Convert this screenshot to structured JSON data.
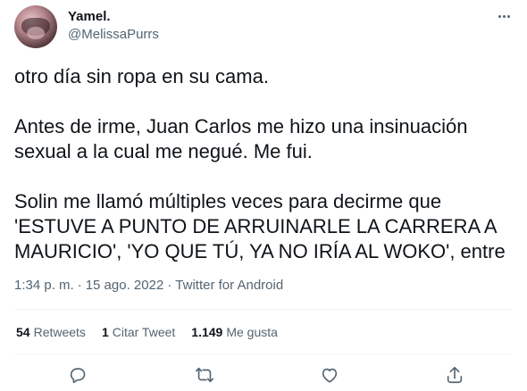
{
  "author": {
    "display_name": "Yamel.",
    "handle": "@MelissaPurrs"
  },
  "tweet": {
    "text": "otro día sin ropa en su cama.\n\nAntes de irme, Juan Carlos me hizo una insinuación\nsexual a la cual me negué. Me fui.\n\nSolin me llamó múltiples veces para decirme que\n'ESTUVE A PUNTO DE ARRUINARLE LA CARRERA A\nMAURICIO', 'YO QUE TÚ, YA NO IRÍA AL WOKO', entre"
  },
  "meta": {
    "time": "1:34 p. m.",
    "separator": "·",
    "date": "15 ago. 2022",
    "source": "Twitter for Android"
  },
  "stats": {
    "retweets_count": "54",
    "retweets_label": "Retweets",
    "quotes_count": "1",
    "quotes_label": "Citar Tweet",
    "likes_count": "1.149",
    "likes_label": "Me gusta"
  },
  "icons": {
    "more": "more-dots-icon",
    "reply": "reply-icon",
    "retweet": "retweet-icon",
    "like": "heart-icon",
    "share": "share-icon"
  },
  "colors": {
    "text_primary": "#0f1419",
    "text_secondary": "#536471",
    "divider": "#eff3f4"
  }
}
